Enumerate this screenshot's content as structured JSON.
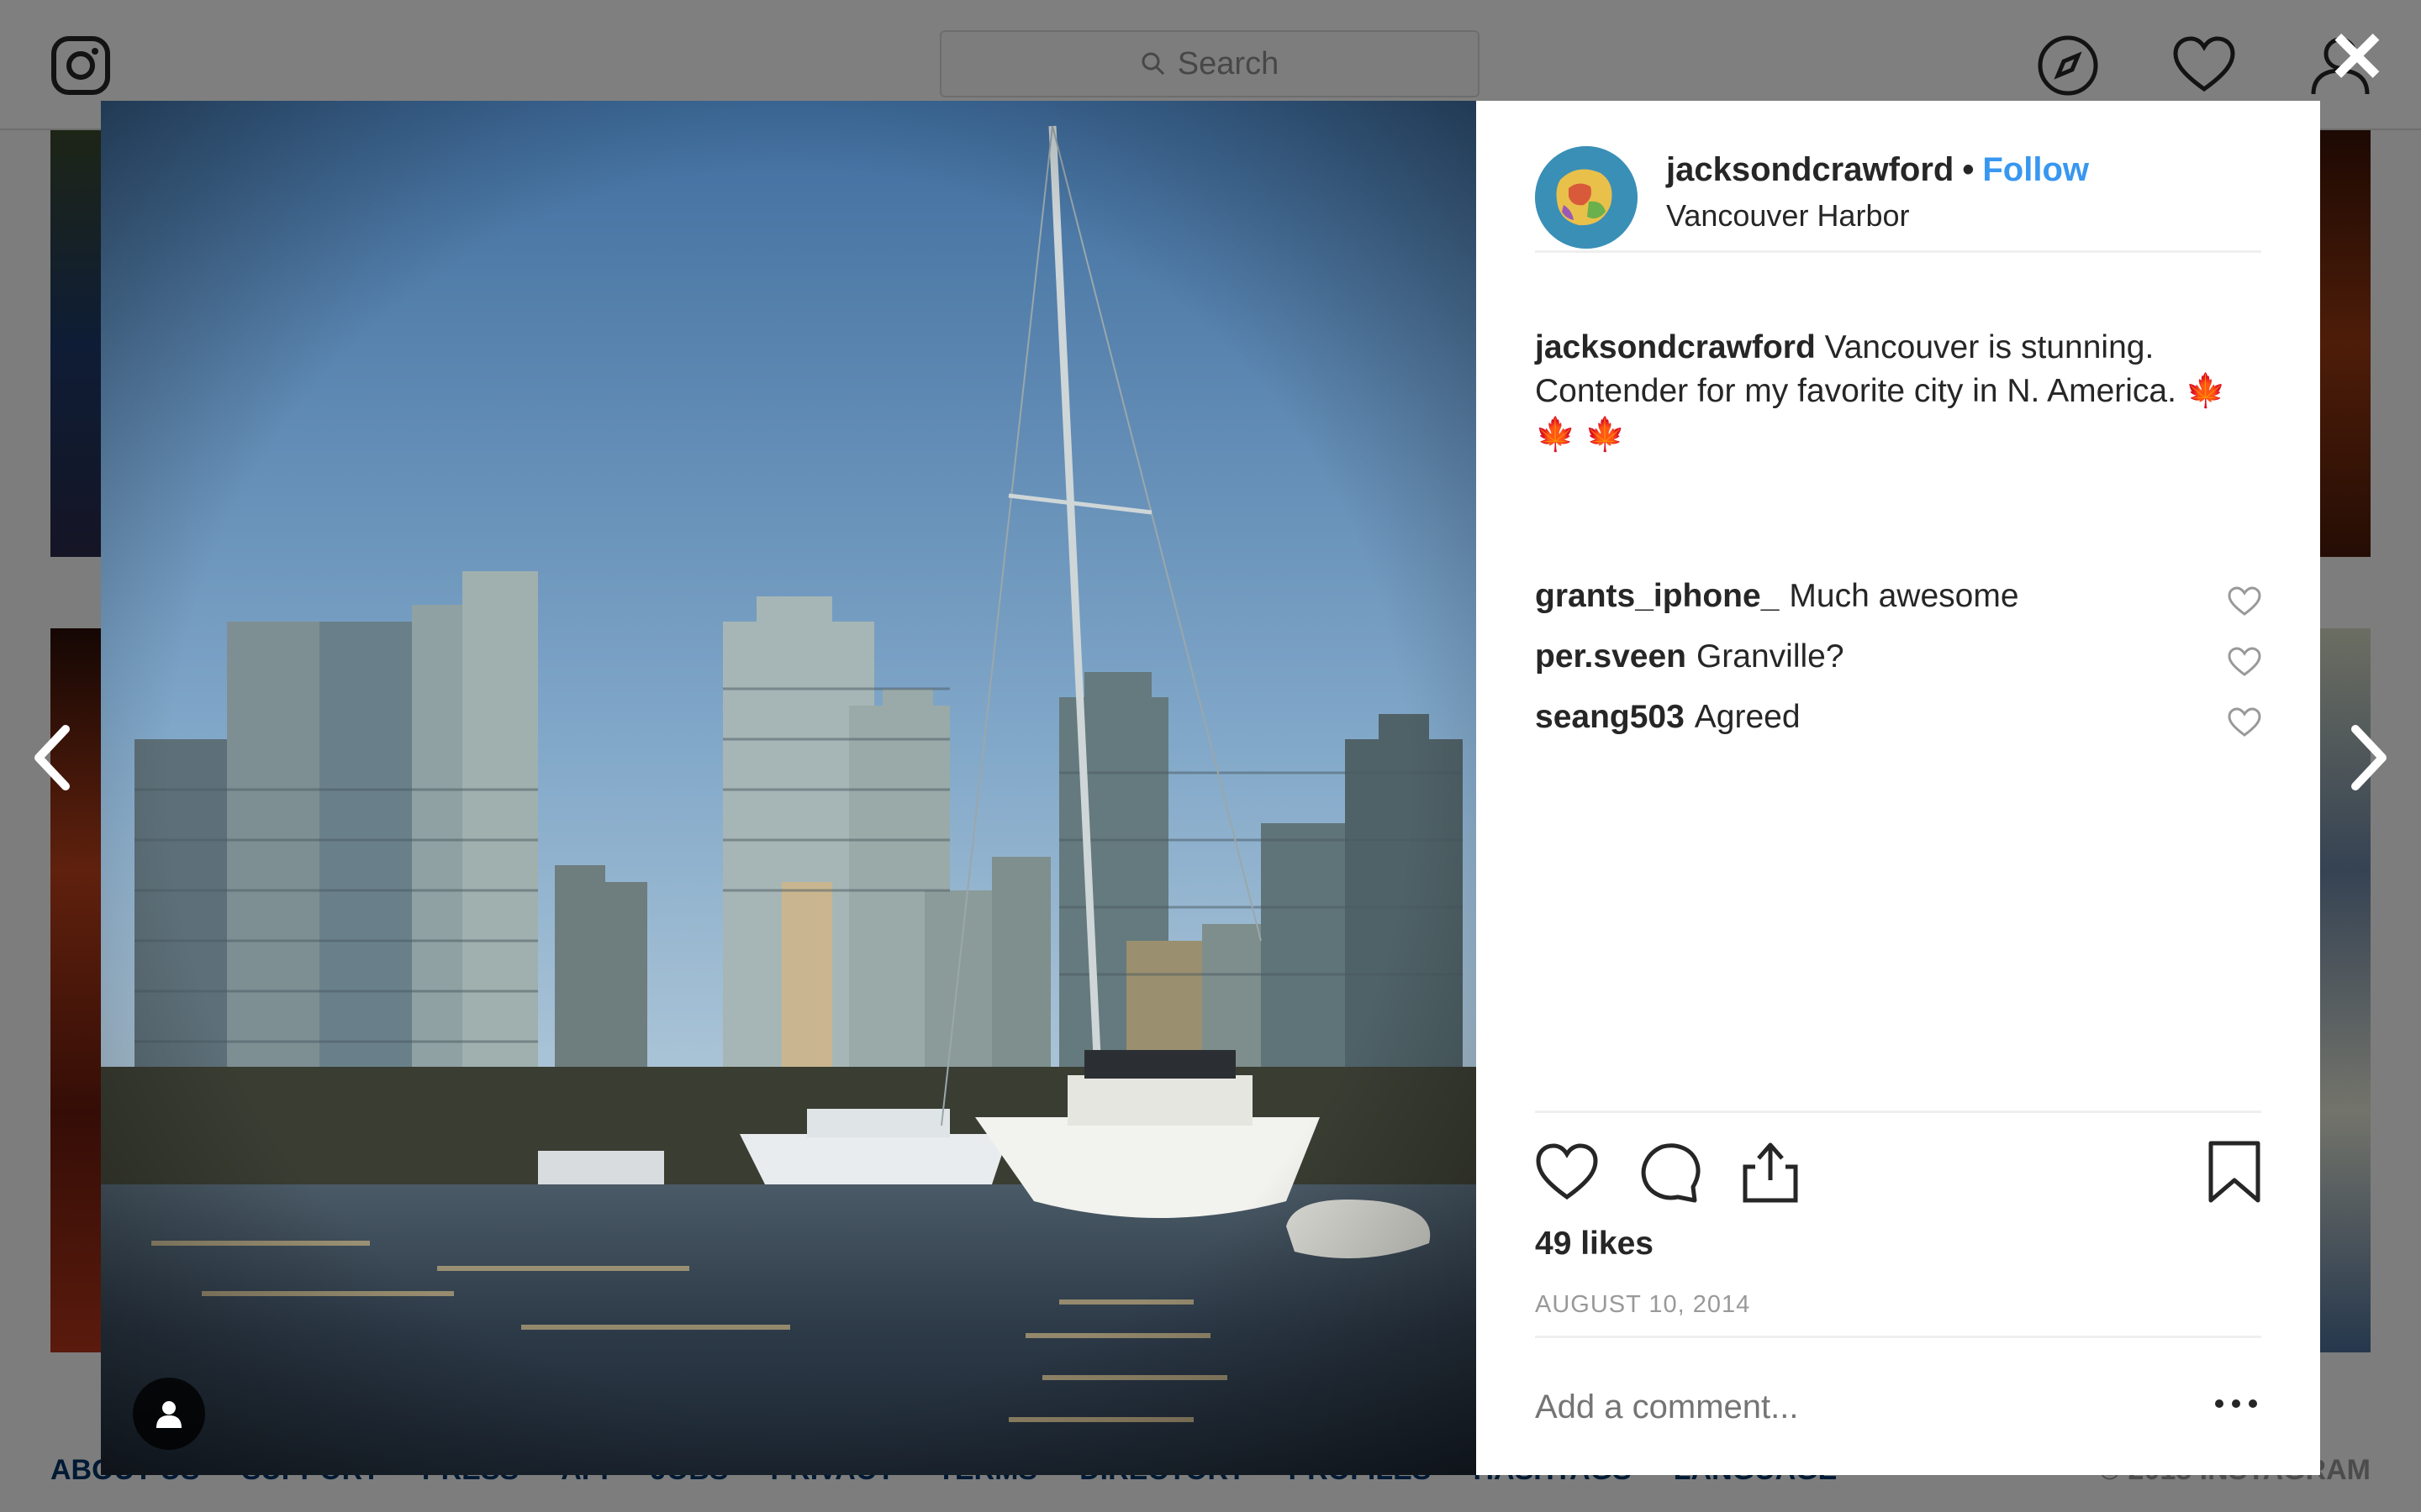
{
  "topbar": {
    "search_placeholder": "Search"
  },
  "footer": {
    "links": [
      "ABOUT US",
      "SUPPORT",
      "PRESS",
      "API",
      "JOBS",
      "PRIVACY",
      "TERMS",
      "DIRECTORY",
      "PROFILES",
      "HASHTAGS",
      "LANGUAGE"
    ],
    "copyright": "© 2018 INSTAGRAM"
  },
  "modal": {
    "close_label": "✕",
    "post": {
      "username": "jacksondcrawford",
      "separator": "•",
      "follow_label": "Follow",
      "location": "Vancouver Harbor",
      "caption_text": "Vancouver is stunning. Contender for my favorite city in N. America.",
      "caption_emoji": "🍁 🍁 🍁",
      "comments": [
        {
          "user": "grants_iphone_",
          "text": "Much awesome"
        },
        {
          "user": "per.sveen",
          "text": "Granville?"
        },
        {
          "user": "seang503",
          "text": "Agreed"
        }
      ],
      "likes": "49 likes",
      "date": "AUGUST 10, 2014",
      "comment_placeholder": "Add a comment..."
    }
  },
  "colors": {
    "accent": "#3897f0",
    "text": "#262626",
    "muted": "#999999",
    "overlay": "rgba(0,0,0,0.5)"
  },
  "icons": [
    "instagram-logo-icon",
    "search-icon",
    "explore-compass-icon",
    "activity-heart-icon",
    "profile-icon",
    "close-icon",
    "chevron-left-icon",
    "chevron-right-icon",
    "tagged-user-icon",
    "like-heart-icon",
    "comment-bubble-icon",
    "share-icon",
    "bookmark-icon",
    "more-options-icon"
  ]
}
